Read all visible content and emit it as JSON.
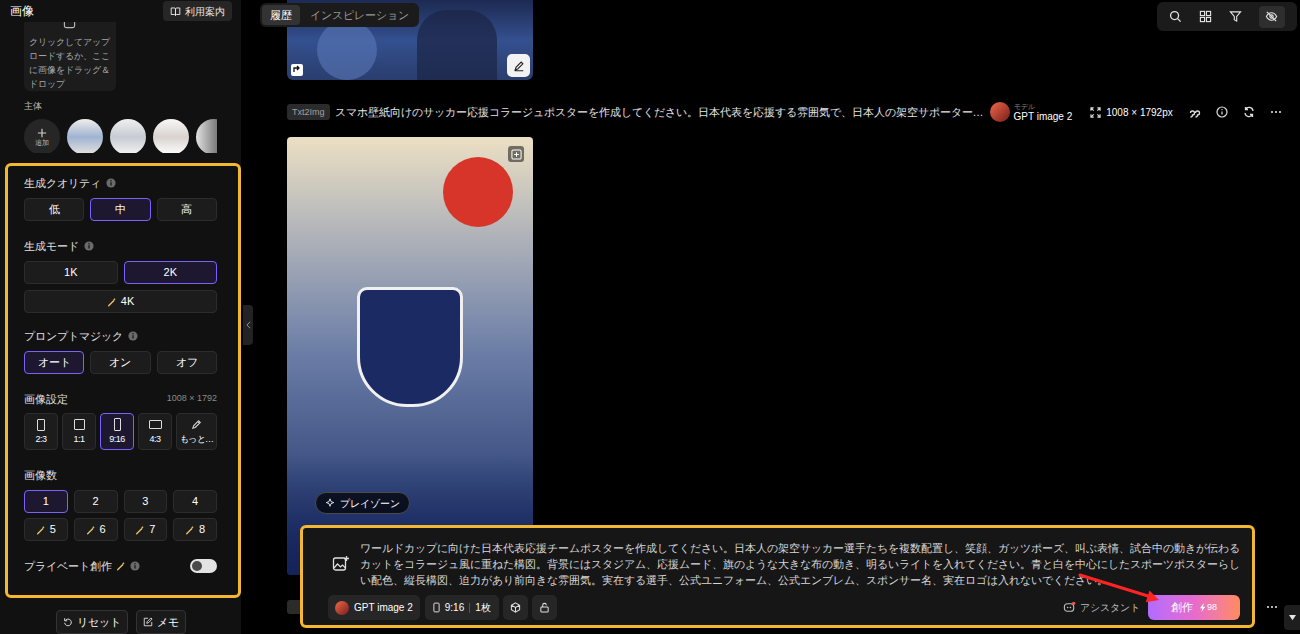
{
  "panel": {
    "title": "画像",
    "guide_button": "利用案内",
    "upload_text": "クリックしてアップロードするか、ここに画像をドラッグ＆ドロップ",
    "subject_label": "主体",
    "add_label": "追加",
    "settings": {
      "quality": {
        "label": "生成クオリティ",
        "info": true,
        "options": [
          {
            "label": "低",
            "selected": false,
            "premium": false
          },
          {
            "label": "中",
            "selected": true,
            "premium": false
          },
          {
            "label": "高",
            "selected": false,
            "premium": false
          }
        ]
      },
      "mode": {
        "label": "生成モード",
        "info": true,
        "options": [
          {
            "label": "1K",
            "selected": false,
            "premium": false
          },
          {
            "label": "2K",
            "selected": true,
            "premium": false
          },
          {
            "label": "4K",
            "selected": false,
            "premium": true
          }
        ]
      },
      "magic": {
        "label": "プロンプトマジック",
        "info": true,
        "options": [
          {
            "label": "オート",
            "selected": true,
            "premium": false
          },
          {
            "label": "オン",
            "selected": false,
            "premium": false
          },
          {
            "label": "オフ",
            "selected": false,
            "premium": false
          }
        ]
      },
      "image": {
        "label": "画像設定",
        "info": false,
        "size": "1008 × 1792",
        "ratios": [
          {
            "label": "2:3",
            "kind": "portrait",
            "selected": false
          },
          {
            "label": "1:1",
            "kind": "square",
            "selected": false
          },
          {
            "label": "9:16",
            "kind": "tall",
            "selected": true
          },
          {
            "label": "4:3",
            "kind": "landscape",
            "selected": false
          },
          {
            "label": "もっと…",
            "kind": "custom",
            "selected": false
          }
        ]
      },
      "count": {
        "label": "画像数",
        "info": false,
        "options": [
          {
            "label": "1",
            "selected": true,
            "premium": false
          },
          {
            "label": "2",
            "selected": false,
            "premium": false
          },
          {
            "label": "3",
            "selected": false,
            "premium": false
          },
          {
            "label": "4",
            "selected": false,
            "premium": false
          },
          {
            "label": "5",
            "selected": false,
            "premium": true
          },
          {
            "label": "6",
            "selected": false,
            "premium": true
          },
          {
            "label": "7",
            "selected": false,
            "premium": true
          },
          {
            "label": "8",
            "selected": false,
            "premium": true
          }
        ]
      },
      "private": {
        "label": "プライベート創作",
        "info": true,
        "premium": true,
        "on": false
      }
    },
    "actions": [
      {
        "label": "リセット"
      },
      {
        "label": "メモ"
      }
    ]
  },
  "main": {
    "tabs": [
      {
        "label": "履歴",
        "selected": true
      },
      {
        "label": "インスピレーション",
        "selected": false
      }
    ],
    "entry": {
      "badge": "Txt2Img",
      "prompt": "スマホ壁紙向けのサッカー応援コラージュポスターを作成してください。日本代表を応援する雰囲気で、日本人の架空サポーター…",
      "model_caption": "モデル",
      "model": "GPT image 2",
      "size": "1008 × 1792px",
      "play_button": "プレイゾーン"
    },
    "composer": {
      "prompt": "ワールドカップに向けた日本代表応援チームポスターを作成してください。日本人の架空サッカー選手たちを複数配置し、笑顔、ガッツポーズ、叫ぶ表情、試合中の動きが伝わるカットをコラージュ風に重ねた構図。背景にはスタジアム、応援ムード、旗のような大きな布の動き、明るいライトを入れてください。青と白を中心にしたスポーツポスターらしい配色、縦長構図、迫力があり前向きな雰囲気。実在する選手、公式ユニフォーム、公式エンブレム、スポンサー名、実在ロゴは入れないでください。",
      "model": "GPT image 2",
      "ratio": "9:16",
      "count": "1枚",
      "assistant": "アシスタント",
      "create": "創作",
      "cost": "98"
    }
  }
}
